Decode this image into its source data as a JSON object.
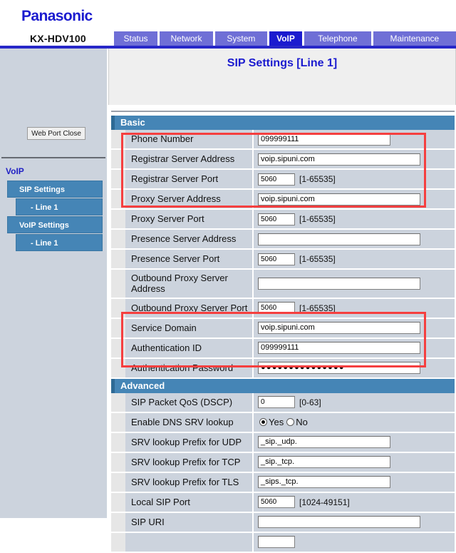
{
  "header": {
    "brand": "Panasonic",
    "model": "KX-HDV100"
  },
  "tabs": [
    {
      "id": "status",
      "label": "Status",
      "active": false
    },
    {
      "id": "network",
      "label": "Network",
      "active": false
    },
    {
      "id": "system",
      "label": "System",
      "active": false
    },
    {
      "id": "voip",
      "label": "VoIP",
      "active": true
    },
    {
      "id": "telephone",
      "label": "Telephone",
      "active": false
    },
    {
      "id": "maintenance",
      "label": "Maintenance",
      "active": false
    }
  ],
  "sidebar": {
    "web_port_close": "Web Port Close",
    "heading": "VoIP",
    "items": [
      {
        "id": "sip-settings",
        "label": "SIP Settings",
        "level": 1
      },
      {
        "id": "line1-sip",
        "label": "- Line 1",
        "level": 2
      },
      {
        "id": "voip-settings",
        "label": "VoIP Settings",
        "level": 1
      },
      {
        "id": "line1-voip",
        "label": "- Line 1",
        "level": 2
      }
    ]
  },
  "main": {
    "page_title": "SIP Settings [Line 1]",
    "sections": {
      "basic_label": "Basic",
      "advanced_label": "Advanced"
    }
  },
  "colors": {
    "brand_blue": "#1b1bcf",
    "tab_inactive": "#6f6fd6",
    "tab_active": "#1b1bcf",
    "nav_blue": "#4585b6",
    "row_bg": "#ccd3dd",
    "highlight_red": "#f53f3f",
    "sidebar_bg": "#ccd3dd"
  },
  "fields": {
    "phone_number": {
      "label": "Phone Number",
      "value": "099999111",
      "hint": ""
    },
    "registrar_server_address": {
      "label": "Registrar Server Address",
      "value": "voip.sipuni.com",
      "hint": ""
    },
    "registrar_server_port": {
      "label": "Registrar Server Port",
      "value": "5060",
      "hint": "[1-65535]"
    },
    "proxy_server_address": {
      "label": "Proxy Server Address",
      "value": "voip.sipuni.com",
      "hint": ""
    },
    "proxy_server_port": {
      "label": "Proxy Server Port",
      "value": "5060",
      "hint": "[1-65535]"
    },
    "presence_server_address": {
      "label": "Presence Server Address",
      "value": "",
      "hint": ""
    },
    "presence_server_port": {
      "label": "Presence Server Port",
      "value": "5060",
      "hint": "[1-65535]"
    },
    "outbound_proxy_address": {
      "label": "Outbound Proxy Server Address",
      "value": "",
      "hint": ""
    },
    "outbound_proxy_port": {
      "label": "Outbound Proxy Server Port",
      "value": "5060",
      "hint": "[1-65535]"
    },
    "service_domain": {
      "label": "Service Domain",
      "value": "voip.sipuni.com",
      "hint": ""
    },
    "authentication_id": {
      "label": "Authentication ID",
      "value": "099999111",
      "hint": ""
    },
    "authentication_password": {
      "label": "Authentication Password",
      "value": "●●●●●●●●●●●●●●●",
      "hint": ""
    },
    "sip_packet_qos": {
      "label": "SIP Packet QoS (DSCP)",
      "value": "0",
      "hint": "[0-63]"
    },
    "enable_dns_srv": {
      "label": "Enable DNS SRV lookup",
      "value": "Yes",
      "options": [
        "Yes",
        "No"
      ]
    },
    "srv_prefix_udp": {
      "label": "SRV lookup Prefix for UDP",
      "value": "_sip._udp.",
      "hint": ""
    },
    "srv_prefix_tcp": {
      "label": "SRV lookup Prefix for TCP",
      "value": "_sip._tcp.",
      "hint": ""
    },
    "srv_prefix_tls": {
      "label": "SRV lookup Prefix for TLS",
      "value": "_sips._tcp.",
      "hint": ""
    },
    "local_sip_port": {
      "label": "Local SIP Port",
      "value": "5060",
      "hint": "[1024-49151]"
    },
    "sip_uri": {
      "label": "SIP URI",
      "value": "",
      "hint": ""
    },
    "cutoff_row": {
      "label": "",
      "value": "",
      "hint": ""
    }
  }
}
